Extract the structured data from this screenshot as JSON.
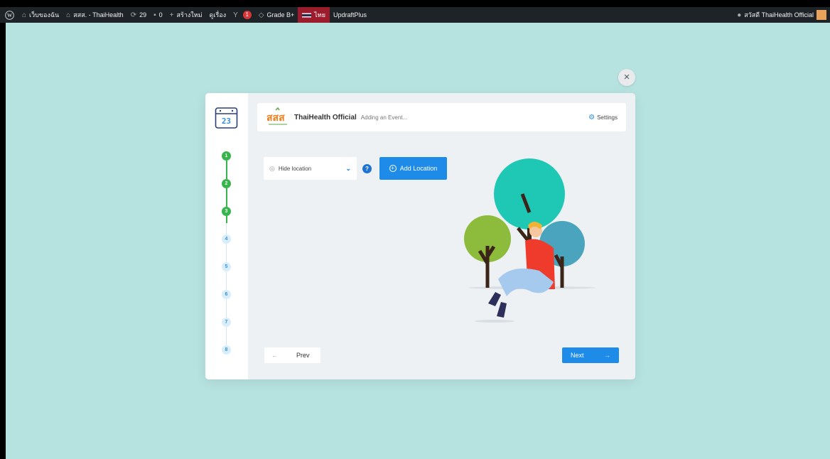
{
  "adminbar": {
    "my_sites": "เว็บของฉัน",
    "site_name": "สสส. - ThaiHealth",
    "updates_count": "29",
    "comments_count": "0",
    "new_label": "สร้างใหม่",
    "view_label": "ดูเรื่อง",
    "yoast_count": "1",
    "grade": "Grade B+",
    "language": "ไทย",
    "updraft": "UpdraftPlus",
    "greeting": "สวัสดี ThaiHealth Official"
  },
  "close_label": "×",
  "header": {
    "brand": "ThaiHealth Official",
    "subtitle": "Adding an Event...",
    "settings_label": "Settings"
  },
  "steps": [
    "1",
    "2",
    "3",
    "4",
    "5",
    "6",
    "7",
    "8"
  ],
  "completed_steps": 3,
  "location": {
    "selected": "Hide location",
    "help": "?",
    "add_label": "Add Location"
  },
  "nav": {
    "prev_label": "Prev",
    "next_label": "Next",
    "prev_arrow": "←",
    "next_arrow": "→"
  },
  "icons": [
    "wordpress-icon",
    "sites-icon",
    "home-icon",
    "refresh-icon",
    "comment-icon",
    "plus-icon",
    "yoast-icon",
    "shield-icon",
    "flag-icon",
    "close-icon",
    "calendar-icon",
    "gear-icon",
    "pin-icon",
    "chevron-down-icon",
    "help-icon"
  ],
  "colors": {
    "page_bg": "#b6e2e0",
    "primary": "#1f8be8",
    "step_done": "#36b54c",
    "adminbar": "#1d2327"
  }
}
